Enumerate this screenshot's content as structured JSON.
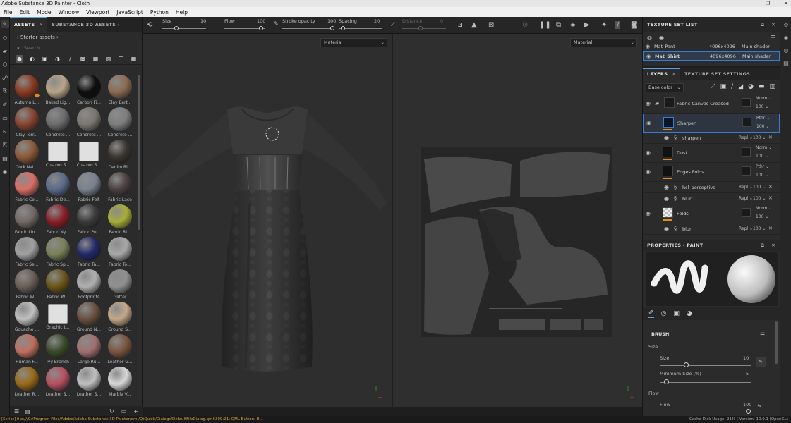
{
  "window": {
    "title": "Adobe Substance 3D Painter - Cloth",
    "controls": [
      "—",
      "❐",
      "✕"
    ]
  },
  "menu": [
    "File",
    "Edit",
    "Mode",
    "Window",
    "Viewport",
    "JavaScript",
    "Python",
    "Help"
  ],
  "assets_panel": {
    "tabs": [
      {
        "label": "ASSETS",
        "close": "✕"
      },
      {
        "label": "SUBSTANCE 3D ASSETS",
        "chevron": "›"
      }
    ],
    "breadcrumb": "›  Starter assets  ›",
    "search_placeholder": "Search",
    "items": [
      {
        "label": "Autumn L...",
        "color": "#8a3a20",
        "badge": true
      },
      {
        "label": "Baked Lig...",
        "color": "#b9a48a"
      },
      {
        "label": "Carbon Fi...",
        "color": "#0d0d0d"
      },
      {
        "label": "Clay Eart...",
        "color": "#8b6a52"
      },
      {
        "label": "Clay Terr...",
        "color": "#874430"
      },
      {
        "label": "Concrete ...",
        "color": "#6c6c6c"
      },
      {
        "label": "Concrete ...",
        "color": "#7b7770"
      },
      {
        "label": "Concrete ...",
        "color": "#7e7e7e"
      },
      {
        "label": "Cork Nat...",
        "color": "#8c5a3a"
      },
      {
        "label": "Custom S...",
        "color": "#dddddd",
        "square": true
      },
      {
        "label": "Custom S...",
        "color": "#dddddd",
        "square": true
      },
      {
        "label": "Denim Ri...",
        "color": "#3a3530"
      },
      {
        "label": "Fabric Co...",
        "color": "#d96e66"
      },
      {
        "label": "Fabric De...",
        "color": "#5a6a8a"
      },
      {
        "label": "Fabric Felt",
        "color": "#7a8290"
      },
      {
        "label": "Fabric Lace",
        "color": "#4a4040"
      },
      {
        "label": "Fabric Lin...",
        "color": "#726a66"
      },
      {
        "label": "Fabric Ny...",
        "color": "#8a1e28"
      },
      {
        "label": "Fabric Pu...",
        "color": "#3a3a3a"
      },
      {
        "label": "Fabric Ri...",
        "color": "#a8ae38"
      },
      {
        "label": "Fabric Se...",
        "color": "#a0a0a0"
      },
      {
        "label": "Fabric Sp...",
        "color": "#7a8058"
      },
      {
        "label": "Fabric Ta...",
        "color": "#202a6a"
      },
      {
        "label": "Fabric To...",
        "color": "#a8a8a8"
      },
      {
        "label": "Fabric W...",
        "color": "#6a5e58"
      },
      {
        "label": "Fabric W...",
        "color": "#6a5418"
      },
      {
        "label": "Footprints",
        "color": "#b0b0b0"
      },
      {
        "label": "Glitter",
        "color": "#909090"
      },
      {
        "label": "Gouache ...",
        "color": "#c0c0c0"
      },
      {
        "label": "Graphic t...",
        "color": "#dddddd",
        "square": true
      },
      {
        "label": "Ground N...",
        "color": "#6a5040"
      },
      {
        "label": "Ground S...",
        "color": "#c4a888"
      },
      {
        "label": "Human F...",
        "color": "#c07060"
      },
      {
        "label": "Ivy Branch",
        "color": "#3a4a28"
      },
      {
        "label": "Large Ru...",
        "color": "#a07070"
      },
      {
        "label": "Leather G...",
        "color": "#7a5640"
      },
      {
        "label": "Leather R...",
        "color": "#9a6a18"
      },
      {
        "label": "Leather S...",
        "color": "#b85060"
      },
      {
        "label": "Leather S...",
        "color": "#c0c0c0"
      },
      {
        "label": "Marble V...",
        "color": "#d8d8d8"
      }
    ]
  },
  "brush_toolbar": {
    "size_label": "Size",
    "size_value": "10",
    "flow_label": "Flow",
    "flow_value": "100",
    "stroke_label": "Stroke opacity",
    "stroke_value": "100",
    "spacing_label": "Spacing",
    "spacing_value": "20",
    "distance_label": "Distance",
    "distance_value": "0"
  },
  "viewport3d": {
    "mode": "Material"
  },
  "viewport2d": {
    "mode": "Material"
  },
  "texture_set_list": {
    "title": "TEXTURE SET LIST",
    "rows": [
      {
        "name": "Mat_Pant",
        "res": "4096x4096",
        "shader": "Main shader",
        "selected": false
      },
      {
        "name": "Mat_Shirt",
        "res": "4096x4096",
        "shader": "Main shader",
        "selected": true
      }
    ]
  },
  "layers_panel": {
    "tabs": [
      {
        "label": "LAYERS",
        "close": "✕"
      },
      {
        "label": "TEXTURE SET SETTINGS"
      }
    ],
    "channel": "Base color",
    "layers": [
      {
        "type": "folder",
        "name": "Fabric Canvas Creased",
        "blend": "Norm",
        "opacity": "100"
      },
      {
        "type": "layer",
        "name": "Sharpen",
        "blend": "Pthr",
        "opacity": "100",
        "selected": true,
        "thumb": "dark-blue"
      },
      {
        "type": "sub",
        "name": "sharpen",
        "blend": "Repl",
        "opacity": "100"
      },
      {
        "type": "layer",
        "name": "Dust",
        "blend": "Norm",
        "opacity": "100",
        "thumb": "dark"
      },
      {
        "type": "layer",
        "name": "Edges Folds",
        "blend": "Pthr",
        "opacity": "100",
        "thumb": "dark"
      },
      {
        "type": "sub",
        "name": "hsl_perceptive",
        "blend": "Repl",
        "opacity": "100"
      },
      {
        "type": "sub",
        "name": "blur",
        "blend": "Repl",
        "opacity": "100"
      },
      {
        "type": "layer",
        "name": "Folds",
        "blend": "Norm",
        "opacity": "100",
        "thumb": "check"
      },
      {
        "type": "sub",
        "name": "blur",
        "blend": "Repl",
        "opacity": "100"
      }
    ]
  },
  "properties": {
    "title": "PROPERTIES - PAINT",
    "section": "BRUSH",
    "size_group": "Size",
    "size_label": "Size",
    "size_value": "10",
    "min_size_label": "Minimum Size (%)",
    "min_size_value": "5",
    "flow_group": "Flow",
    "flow_label": "Flow",
    "flow_value": "100"
  },
  "status": {
    "left": "[Script] file:///C:/Program Files/Adobe/Adobe Substance 3D Painter/qml/QtQuick/Dialogs/DefaultFileDialog.qml:309:21: QML Button: B...",
    "right": "Cache Disk Usage: 21% | Version: 10.0.1 (OpenGL)"
  },
  "colors": {
    "accent": "#5aa0e6",
    "orange": "#e58a1d",
    "selection": "#3b7bd0"
  }
}
